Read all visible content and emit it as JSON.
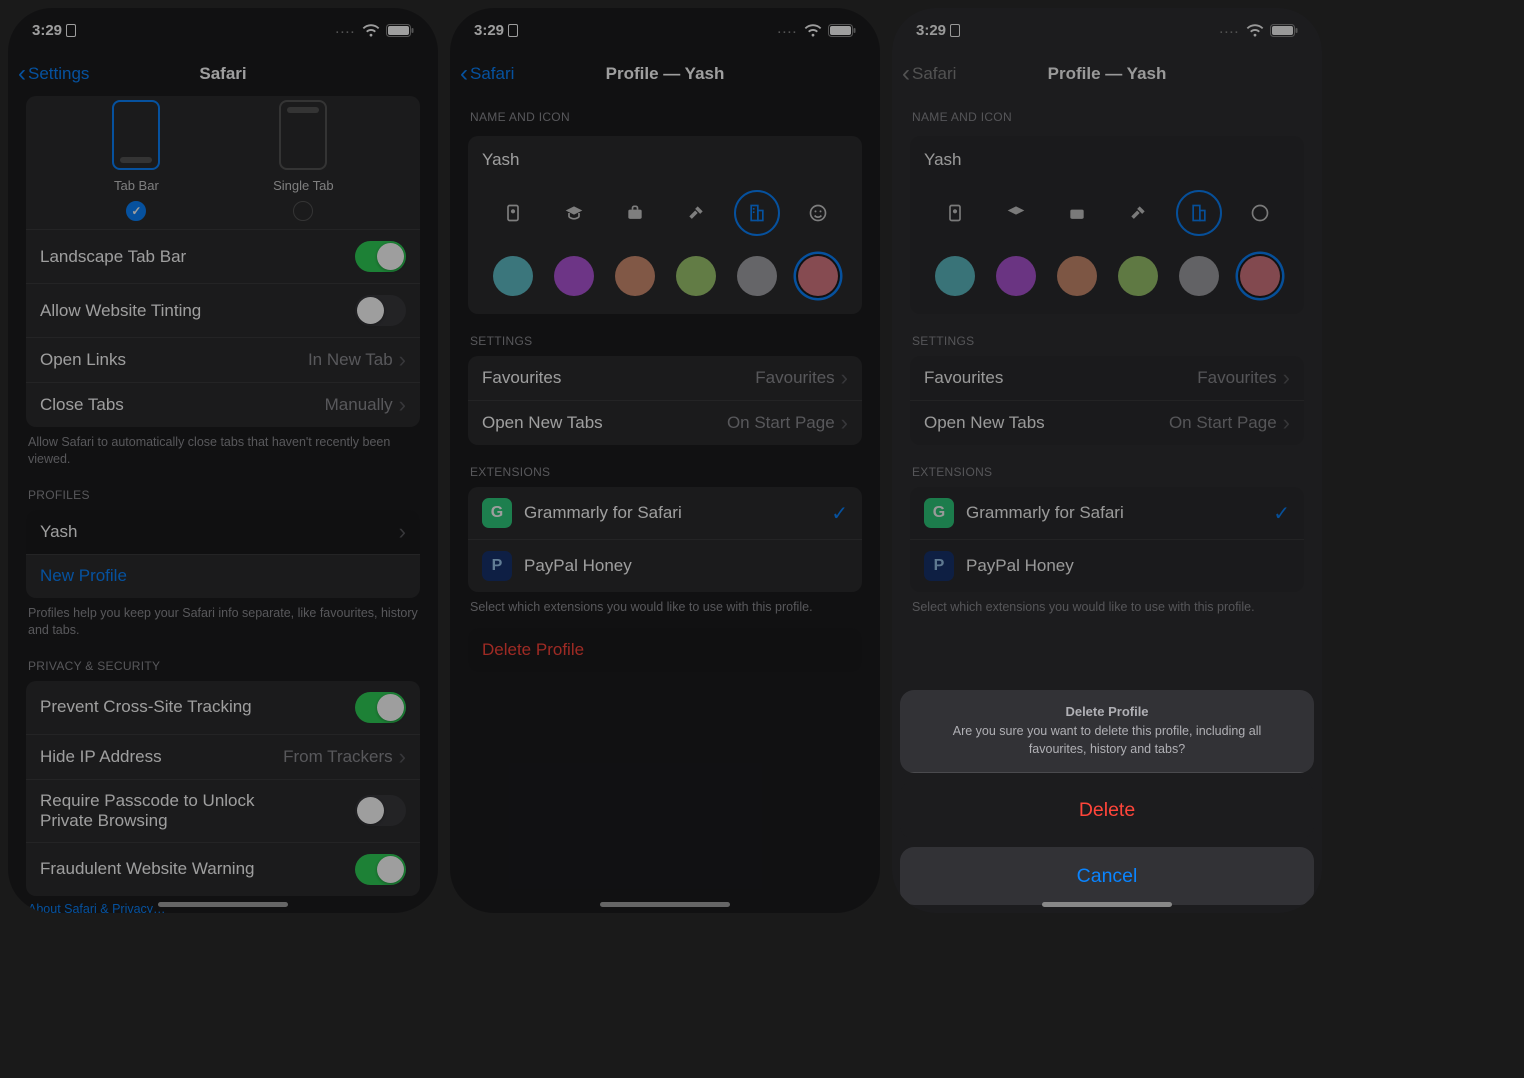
{
  "status": {
    "time": "3:29",
    "dots": "....",
    "wifi": true,
    "battery": 92
  },
  "screen1": {
    "back": "Settings",
    "title": "Safari",
    "tab_styles": {
      "left": "Tab Bar",
      "right": "Single Tab",
      "selected": 0
    },
    "rows": {
      "landscape": "Landscape Tab Bar",
      "tinting": "Allow Website Tinting",
      "open_links": "Open Links",
      "open_links_val": "In New Tab",
      "close_tabs": "Close Tabs",
      "close_tabs_val": "Manually"
    },
    "close_tabs_footer": "Allow Safari to automatically close tabs that haven't recently been viewed.",
    "profiles_header": "PROFILES",
    "profile_item": "Yash",
    "new_profile": "New Profile",
    "profiles_footer": "Profiles help you keep your Safari info separate, like favourites, history and tabs.",
    "privacy_header": "PRIVACY & SECURITY",
    "privacy": {
      "cross_site": "Prevent Cross-Site Tracking",
      "hide_ip": "Hide IP Address",
      "hide_ip_val": "From Trackers",
      "passcode": "Require Passcode to Unlock Private Browsing",
      "fraud": "Fraudulent Website Warning"
    },
    "about_link": "About Safari & Privacy…"
  },
  "screen2": {
    "back": "Safari",
    "title": "Profile — Yash",
    "name_header": "NAME AND ICON",
    "name_value": "Yash",
    "icons": [
      "badge",
      "grad",
      "briefcase",
      "hammer",
      "building",
      "smile"
    ],
    "icon_selected": 4,
    "colors": [
      "#5fbfc8",
      "#b156d9",
      "#d08f72",
      "#9fc970",
      "#a3a3a8",
      "#d87a84"
    ],
    "color_selected": 5,
    "settings_header": "SETTINGS",
    "favourites": "Favourites",
    "favourites_val": "Favourites",
    "new_tabs": "Open New Tabs",
    "new_tabs_val": "On Start Page",
    "ext_header": "EXTENSIONS",
    "extensions": [
      {
        "name": "Grammarly for Safari",
        "checked": true,
        "badge": "G",
        "badge_bg": "#2fce7e"
      },
      {
        "name": "PayPal Honey",
        "checked": false,
        "badge": "P",
        "badge_bg": "#17336f"
      }
    ],
    "ext_footer": "Select which extensions you would like to use with this profile.",
    "delete": "Delete Profile"
  },
  "sheet": {
    "title": "Delete Profile",
    "message": "Are you sure you want to delete this profile, including all favourites, history and tabs?",
    "delete": "Delete",
    "cancel": "Cancel"
  }
}
